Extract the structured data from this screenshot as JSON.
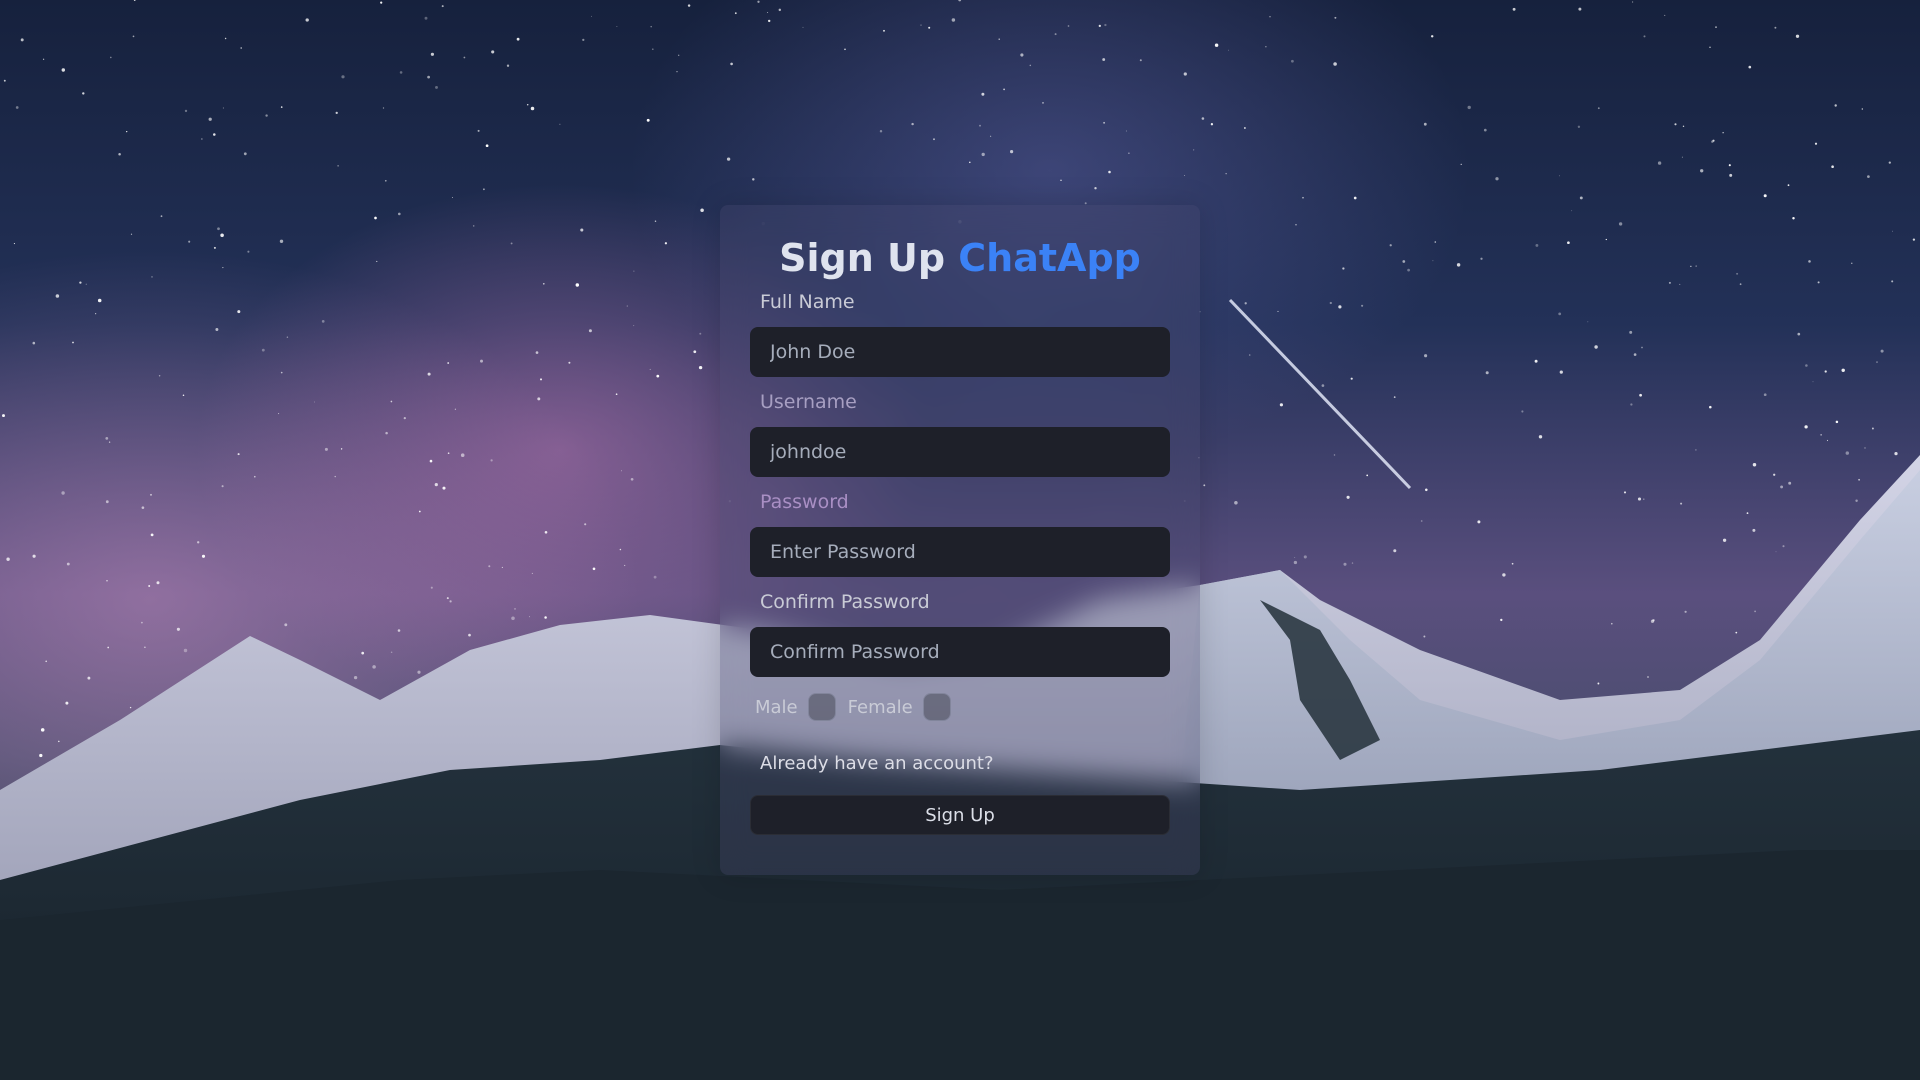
{
  "form": {
    "title_prefix": "Sign Up",
    "title_brand": "ChatApp",
    "full_name": {
      "label": "Full Name",
      "placeholder": "John Doe"
    },
    "username": {
      "label": "Username",
      "placeholder": "johndoe"
    },
    "password": {
      "label": "Password",
      "placeholder": "Enter Password"
    },
    "confirm_password": {
      "label": "Confirm Password",
      "placeholder": "Confirm Password"
    },
    "gender": {
      "male_label": "Male",
      "female_label": "Female"
    },
    "login_link": "Already have an account?",
    "submit_label": "Sign Up"
  },
  "colors": {
    "brand": "#3b82f6",
    "input_background": "#1e2029"
  }
}
